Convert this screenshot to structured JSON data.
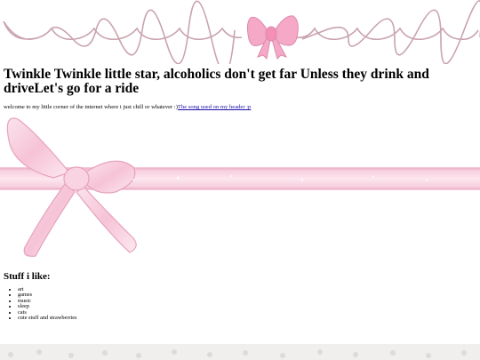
{
  "page": {
    "heading": "Twinkle Twinkle little star, alcoholics don't get far Unless they drink and driveLet's go for a ride",
    "welcome_text": "welcome to my little corner of the internet where i just chill or whatever :)",
    "song_link_text": "The song used on my header :p",
    "stuff_heading": "Stuff i like:",
    "stuff_items": [
      "art",
      "games",
      "music",
      "sleep",
      "cats",
      "cute stuff and strawberries"
    ]
  },
  "colors": {
    "scallop": "#c9a3ad",
    "bow_pink": "#f6a9c6",
    "bow_outline": "#d98aa9",
    "ribbon_pink": "#f9d3e2",
    "link": "#1a0dab"
  },
  "icons": {
    "header_bow": "bow-icon",
    "ribbon_bow": "ribbon-bow-icon"
  }
}
